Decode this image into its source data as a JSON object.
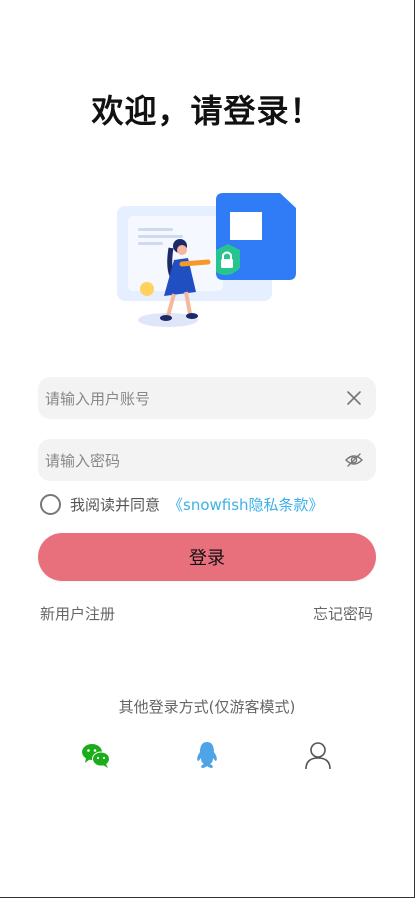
{
  "page": {
    "title": "欢迎，请登录！"
  },
  "form": {
    "username_placeholder": "请输入用户账号",
    "username_value": "",
    "password_placeholder": "请输入密码",
    "password_value": ""
  },
  "agreement": {
    "text": "我阅读并同意",
    "link": "《snowfish隐私条款》",
    "checked": false
  },
  "buttons": {
    "login": "登录",
    "register": "新用户注册",
    "forgot": "忘记密码"
  },
  "other_login": {
    "label": "其他登录方式(仅游客模式)",
    "options": [
      {
        "icon": "wechat-icon",
        "color": "#1aad19"
      },
      {
        "icon": "qq-icon",
        "color": "#4ea4e7"
      },
      {
        "icon": "guest-user-icon",
        "color": "#555555"
      }
    ]
  },
  "colors": {
    "accent_link": "#3bb1e6",
    "login_button": "#e8707d",
    "field_bg": "#f3f3f3"
  }
}
